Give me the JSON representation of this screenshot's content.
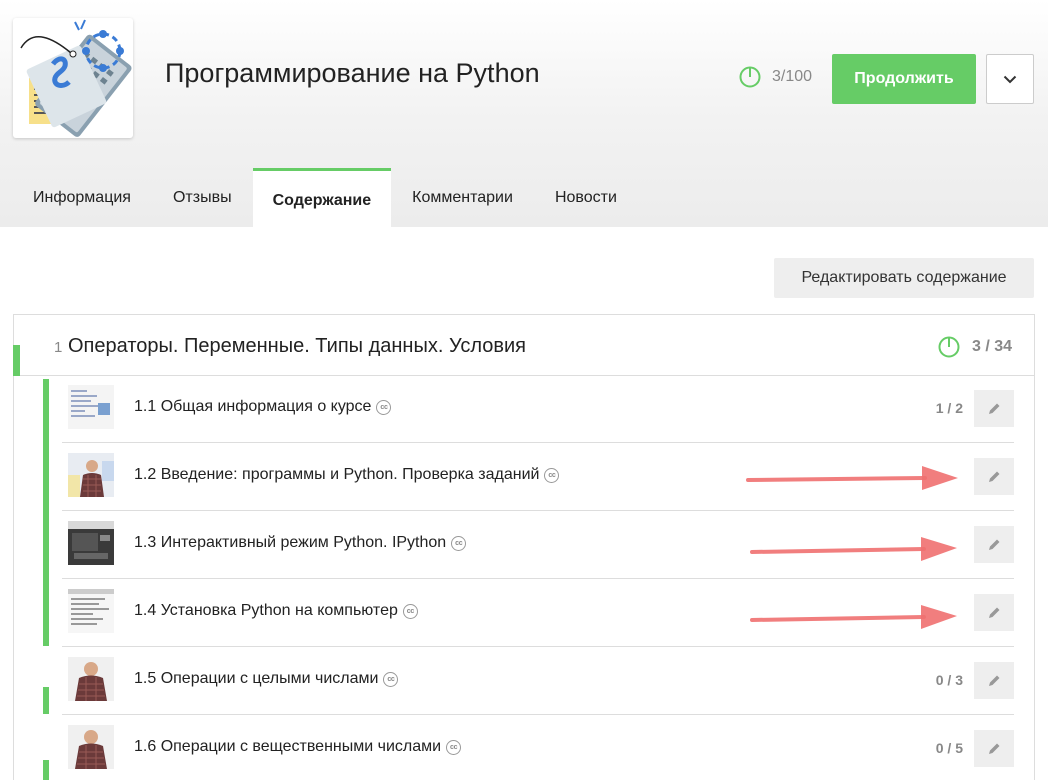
{
  "course": {
    "title": "Программирование на Python",
    "progress": "3/100",
    "progress_fraction": 0.03,
    "continue_label": "Продолжить"
  },
  "tabs": [
    {
      "label": "Информация",
      "active": false
    },
    {
      "label": "Отзывы",
      "active": false
    },
    {
      "label": "Содержание",
      "active": true
    },
    {
      "label": "Комментарии",
      "active": false
    },
    {
      "label": "Новости",
      "active": false
    }
  ],
  "edit_content_label": "Редактировать содержание",
  "module": {
    "number": "1",
    "title": "Операторы. Переменные. Типы данных. Условия",
    "progress": "3 / 34",
    "progress_fraction": 0.088
  },
  "lessons": [
    {
      "title": "1.1 Общая информация о курсе",
      "progress": "1 / 2",
      "cc": "cc"
    },
    {
      "title": "1.2 Введение: программы и Python. Проверка заданий",
      "progress": "",
      "cc": "cc"
    },
    {
      "title": "1.3 Интерактивный режим Python. IPython",
      "progress": "",
      "cc": "cc"
    },
    {
      "title": "1.4 Установка Python на компьютер",
      "progress": "",
      "cc": "cc"
    },
    {
      "title": "1.5 Операции с целыми числами",
      "progress": "0 / 3",
      "cc": "cc"
    },
    {
      "title": "1.6 Операции с вещественными числами",
      "progress": "0 / 5",
      "cc": "cc"
    }
  ],
  "colors": {
    "accent": "#66cc66",
    "annotation_arrow": "#f07070"
  },
  "icons": {
    "progress": "progress-ring-icon",
    "dropdown": "chevron-down-icon",
    "edit": "pencil-icon",
    "captions": "cc-icon"
  }
}
